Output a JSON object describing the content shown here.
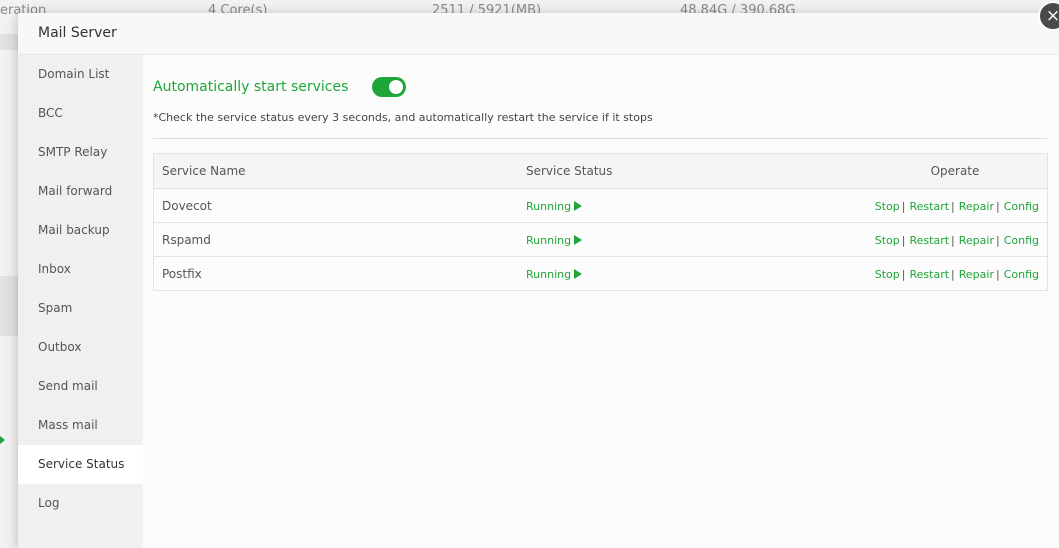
{
  "background": {
    "row_label": "eration",
    "cpu": "4 Core(s)",
    "memory": "2511 / 5921(MB)",
    "disk": "48.84G / 390.68G"
  },
  "modal": {
    "title": "Mail Server",
    "close_symbol": "×"
  },
  "sidebar": {
    "items": [
      {
        "label": "Domain List"
      },
      {
        "label": "BCC"
      },
      {
        "label": "SMTP Relay"
      },
      {
        "label": "Mail forward"
      },
      {
        "label": "Mail backup"
      },
      {
        "label": "Inbox"
      },
      {
        "label": "Spam"
      },
      {
        "label": "Outbox"
      },
      {
        "label": "Send mail"
      },
      {
        "label": "Mass mail"
      },
      {
        "label": "Service Status"
      },
      {
        "label": "Log"
      }
    ],
    "active_index": 10
  },
  "service_status": {
    "auto_start_label": "Automatically start services",
    "auto_start_enabled": true,
    "note": "*Check the service status every 3 seconds, and automatically restart the service if it stops",
    "columns": {
      "name": "Service Name",
      "status": "Service Status",
      "operate": "Operate"
    },
    "rows": [
      {
        "name": "Dovecot",
        "status": "Running"
      },
      {
        "name": "Rspamd",
        "status": "Running"
      },
      {
        "name": "Postfix",
        "status": "Running"
      }
    ],
    "operations": {
      "stop": "Stop",
      "restart": "Restart",
      "repair": "Repair",
      "config": "Config",
      "separator": "|"
    }
  },
  "colors": {
    "accent": "#20a53a",
    "close_button": "#4a4a4a"
  }
}
